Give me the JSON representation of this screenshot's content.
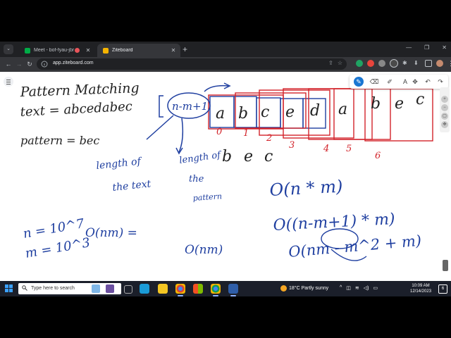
{
  "browser": {
    "tabs": [
      {
        "title": "Meet - bof-fyau-jbr",
        "icon": "meet-icon",
        "active": false
      },
      {
        "title": "Ziteboard",
        "icon": "ziteboard-icon",
        "active": true
      }
    ],
    "new_tab": "+",
    "url": "app.ziteboard.com",
    "window_controls": [
      "—",
      "❐",
      "✕"
    ]
  },
  "whiteboard": {
    "active_tool": "pen",
    "ink_colors": {
      "blue": "#1f3fa0",
      "red": "#d2232a",
      "black": "#222222"
    },
    "notes": {
      "title": "Pattern Matching",
      "text_line": "text = abcedabec",
      "pattern_line": "pattern = bec",
      "text_chars": [
        "a",
        "b",
        "c",
        "e",
        "d",
        "a",
        "b",
        "e",
        "c"
      ],
      "index_labels": [
        "0",
        "1",
        "2",
        "3",
        "4",
        "5",
        "6"
      ],
      "pattern_chars": [
        "b",
        "e",
        "c"
      ],
      "bracket_expr": "n-m+1",
      "length_text": [
        "length of",
        "the text"
      ],
      "length_pattern": [
        "length of",
        "the",
        "pattern"
      ],
      "n_eq": "n = 10^7",
      "m_eq": "m = 10^3",
      "o_nm_left": "O(nm) =",
      "o_nm_mid": "O(nm)",
      "big_o_1": "O(n * m)",
      "big_o_2": "O((n-m+1) * m)",
      "big_o_3": "O(nm - m^2 + m)"
    }
  },
  "taskbar": {
    "search_placeholder": "Type here to search",
    "weather": "18°C  Partly sunny",
    "time": "10:09 AM",
    "date": "12/14/2023",
    "notifications": "6"
  }
}
